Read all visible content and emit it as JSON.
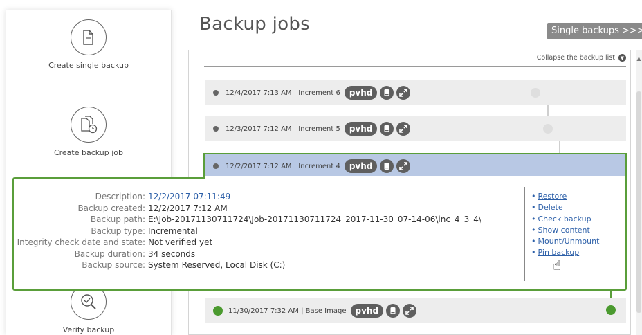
{
  "sidebar": {
    "items": [
      {
        "label": "Create single backup",
        "icon": "single-document-icon"
      },
      {
        "label": "Create backup job",
        "icon": "scheduled-documents-icon"
      },
      {
        "label": "Verify backup",
        "icon": "magnifier-check-icon"
      }
    ]
  },
  "page": {
    "title": "Backup jobs",
    "single_backups_link": "Single backups >>>",
    "collapse_label": "Collapse the backup list"
  },
  "rows": [
    {
      "text": "12/4/2017 7:13 AM | Increment 6",
      "badge": "pvhd"
    },
    {
      "text": "12/3/2017 7:12 AM | Increment 5",
      "badge": "pvhd"
    },
    {
      "text": "12/2/2017 7:12 AM | Increment 4",
      "badge": "pvhd"
    },
    {
      "text": "11/30/2017 7:32 AM | Base Image",
      "badge": "pvhd"
    }
  ],
  "details": {
    "description_label": "Description:",
    "description_value": "12/2/2017 07:11:49",
    "created_label": "Backup created:",
    "created_value": "12/2/2017 7:12 AM",
    "path_label": "Backup path:",
    "path_value": "E:\\Job-20171130711724\\Job-20171130711724_2017-11-30_07-14-06\\inc_4_3_4\\",
    "type_label": "Backup type:",
    "type_value": "Incremental",
    "integrity_label": "Integrity check date and state:",
    "integrity_value": "Not verified yet",
    "duration_label": "Backup duration:",
    "duration_value": "34 seconds",
    "source_label": "Backup source:",
    "source_value": "System Reserved, Local Disk (C:)"
  },
  "actions": [
    "Restore",
    "Delete",
    "Check backup",
    "Show content",
    "Mount/Unmount",
    "Pin backup"
  ],
  "colors": {
    "accent_green": "#5a9e3a",
    "selected_row": "#b8c8e4",
    "link_blue": "#2c5fa8",
    "badge_gray": "#5f5f5f"
  }
}
